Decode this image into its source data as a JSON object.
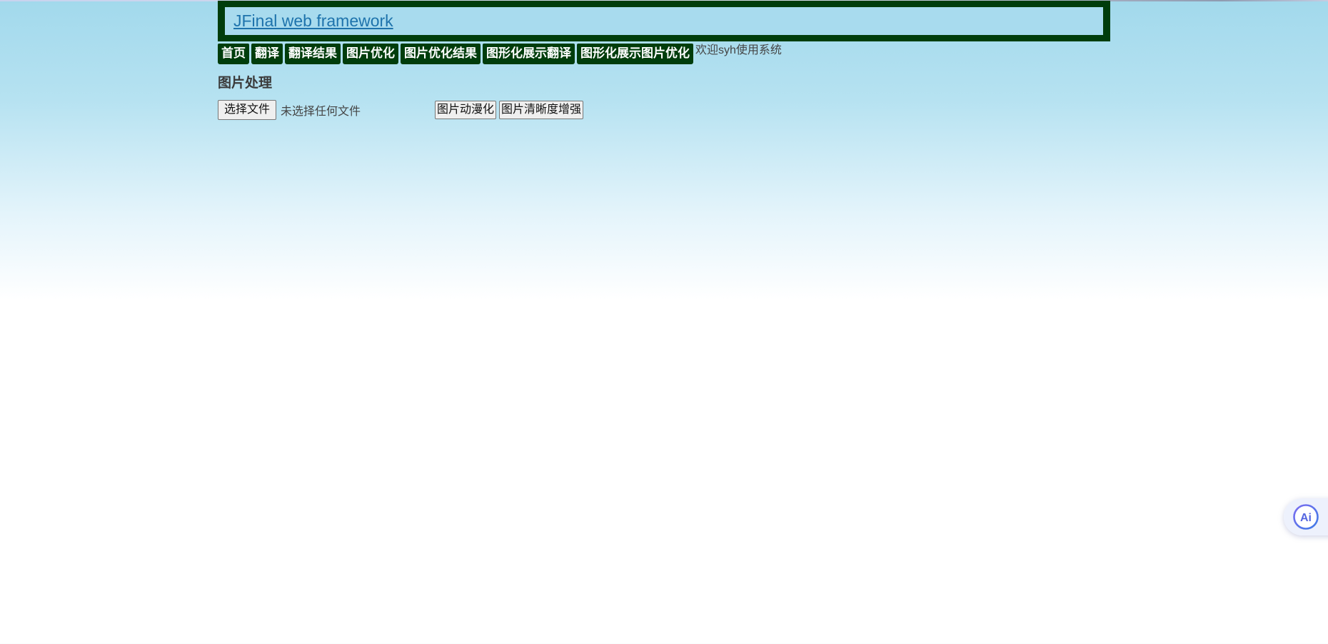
{
  "header": {
    "title": "JFinal web framework"
  },
  "nav": {
    "items": [
      "首页",
      "翻译",
      "翻译结果",
      "图片优化",
      "图片优化结果",
      "图形化展示翻译",
      "图形化展示图片优化"
    ],
    "welcome": "欢迎syh使用系统"
  },
  "main": {
    "title": "图片处理",
    "file_button_label": "选择文件",
    "file_status": "未选择任何文件",
    "actions": [
      "图片动漫化",
      "图片清晰度增强"
    ]
  },
  "floating": {
    "icon": "ai-assistant-icon",
    "label": "Ai"
  },
  "colors": {
    "nav_bg": "#003d0c",
    "link": "#1e73ac",
    "sky": "#a2d9ec"
  }
}
